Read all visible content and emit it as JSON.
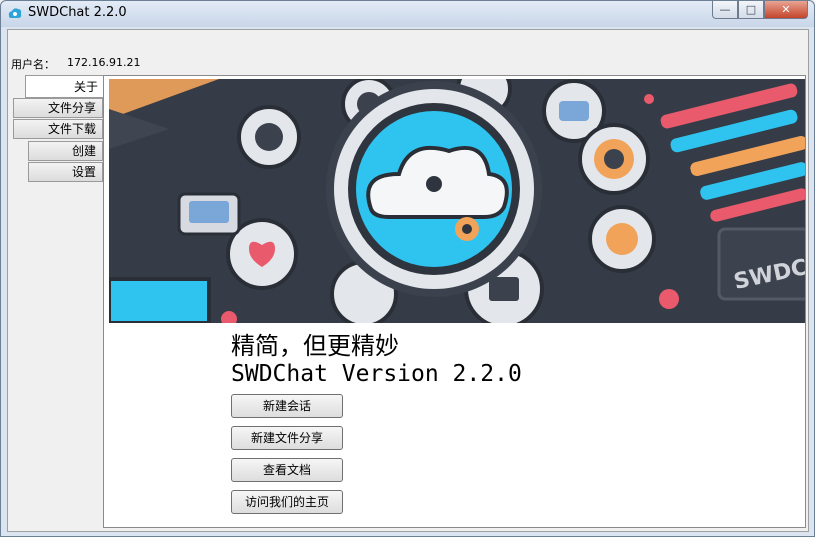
{
  "window": {
    "title": "SWDChat 2.2.0",
    "min_label": "—",
    "max_label": "□",
    "close_label": "✕"
  },
  "user": {
    "label": "用户名：",
    "value": "172.16.91.21"
  },
  "tabs": [
    {
      "label": "关于",
      "active": true
    },
    {
      "label": "文件分享",
      "active": false
    },
    {
      "label": "文件下载",
      "active": false
    },
    {
      "label": "创建",
      "active": false
    },
    {
      "label": "设置",
      "active": false
    }
  ],
  "about": {
    "banner_text": "SWDC",
    "slogan": "精简，但更精妙",
    "version": "SWDChat Version 2.2.0",
    "buttons": {
      "new_session": "新建会话",
      "new_share": "新建文件分享",
      "view_docs": "查看文档",
      "visit_home": "访问我们的主页"
    }
  },
  "colors": {
    "accent": "#2ec4ef",
    "banner_bg": "#333a44",
    "orange": "#f2a35a",
    "pink": "#e85a6c"
  }
}
